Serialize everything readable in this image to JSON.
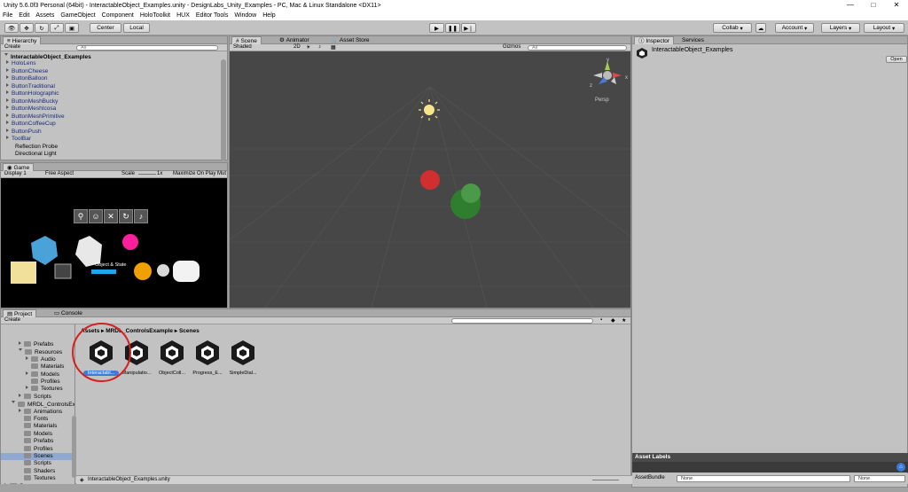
{
  "window": {
    "title": "Unity 5.6.0f3 Personal (64bit) - InteractableObject_Examples.unity - DesignLabs_Unity_Examples - PC, Mac & Linux Standalone <DX11>",
    "minimize": "—",
    "maximize": "□",
    "close": "✕"
  },
  "menu": [
    "File",
    "Edit",
    "Assets",
    "GameObject",
    "Component",
    "HoloToolkit",
    "HUX",
    "Editor Tools",
    "Window",
    "Help"
  ],
  "toolbar": {
    "center": "Center",
    "local": "Local",
    "collab": "Collab",
    "account": "Account",
    "layers": "Layers",
    "layout": "Layout"
  },
  "hierarchy": {
    "tab": "Hierarchy",
    "create": "Create",
    "search": "All",
    "scene": "InteractableObject_Examples",
    "items": [
      "HoloLens",
      "ButtonCheese",
      "ButtonBalloon",
      "ButtonTraditional",
      "ButtonHolographic",
      "ButtonMeshBucky",
      "ButtonMeshIcosa",
      "ButtonMeshPrimitive",
      "ButtonCoffeeCup",
      "ButtonPush",
      "ToolBar"
    ],
    "plain_items": [
      "Reflection Probe",
      "Directional Light"
    ]
  },
  "game": {
    "tab": "Game",
    "display": "Display 1",
    "aspect": "Free Aspect",
    "scale_label": "Scale",
    "scale_value": "1x",
    "maximize": "Maximize On Play",
    "mute": "Mut",
    "object_state": "Object & State"
  },
  "scene": {
    "tabs": [
      "Scene",
      "Animator",
      "Asset Store"
    ],
    "shaded": "Shaded",
    "mode_2d": "2D",
    "gizmos": "Gizmos",
    "search": "All",
    "persp": "Persp",
    "gizmo_axes": [
      "y",
      "x",
      "z"
    ]
  },
  "inspector": {
    "tabs": [
      "Inspector",
      "Services"
    ],
    "object": "InteractableObject_Examples",
    "open": "Open",
    "asset_labels": "Asset Labels",
    "asset_bundle": "AssetBundle",
    "bundle_value": "None",
    "variant_value": "None"
  },
  "project": {
    "tabs": [
      "Project",
      "Console"
    ],
    "create": "Create",
    "breadcrumb": [
      "Assets",
      "MRDL_ControlsExample",
      "Scenes"
    ],
    "tree": [
      {
        "label": "Prefabs",
        "indent": 2,
        "arrow": "right"
      },
      {
        "label": "Resources",
        "indent": 2,
        "arrow": "down"
      },
      {
        "label": "Audio",
        "indent": 3,
        "arrow": "right"
      },
      {
        "label": "Materials",
        "indent": 3,
        "arrow": ""
      },
      {
        "label": "Models",
        "indent": 3,
        "arrow": "right"
      },
      {
        "label": "Profiles",
        "indent": 3,
        "arrow": ""
      },
      {
        "label": "Textures",
        "indent": 3,
        "arrow": "right"
      },
      {
        "label": "Scripts",
        "indent": 2,
        "arrow": "right"
      },
      {
        "label": "MRDL_ControlsEx",
        "indent": 1,
        "arrow": "down"
      },
      {
        "label": "Animations",
        "indent": 2,
        "arrow": "right"
      },
      {
        "label": "Fonts",
        "indent": 2,
        "arrow": ""
      },
      {
        "label": "Materials",
        "indent": 2,
        "arrow": ""
      },
      {
        "label": "Models",
        "indent": 2,
        "arrow": ""
      },
      {
        "label": "Prefabs",
        "indent": 2,
        "arrow": ""
      },
      {
        "label": "Profiles",
        "indent": 2,
        "arrow": ""
      },
      {
        "label": "Scenes",
        "indent": 2,
        "arrow": "",
        "selected": true
      },
      {
        "label": "Scripts",
        "indent": 2,
        "arrow": ""
      },
      {
        "label": "Shaders",
        "indent": 2,
        "arrow": ""
      },
      {
        "label": "Textures",
        "indent": 2,
        "arrow": ""
      },
      {
        "label": "Scene",
        "indent": 0,
        "arrow": "right"
      }
    ],
    "assets": [
      "Interactabl...",
      "Manipulatio...",
      "ObjectColl...",
      "Progress_E...",
      "SimpleDial..."
    ],
    "status": "InteractableObject_Examples.unity"
  },
  "colors": {
    "selection": "#3d7bd9",
    "scene_bg": "#474747",
    "highlight_circle": "#d62020"
  }
}
